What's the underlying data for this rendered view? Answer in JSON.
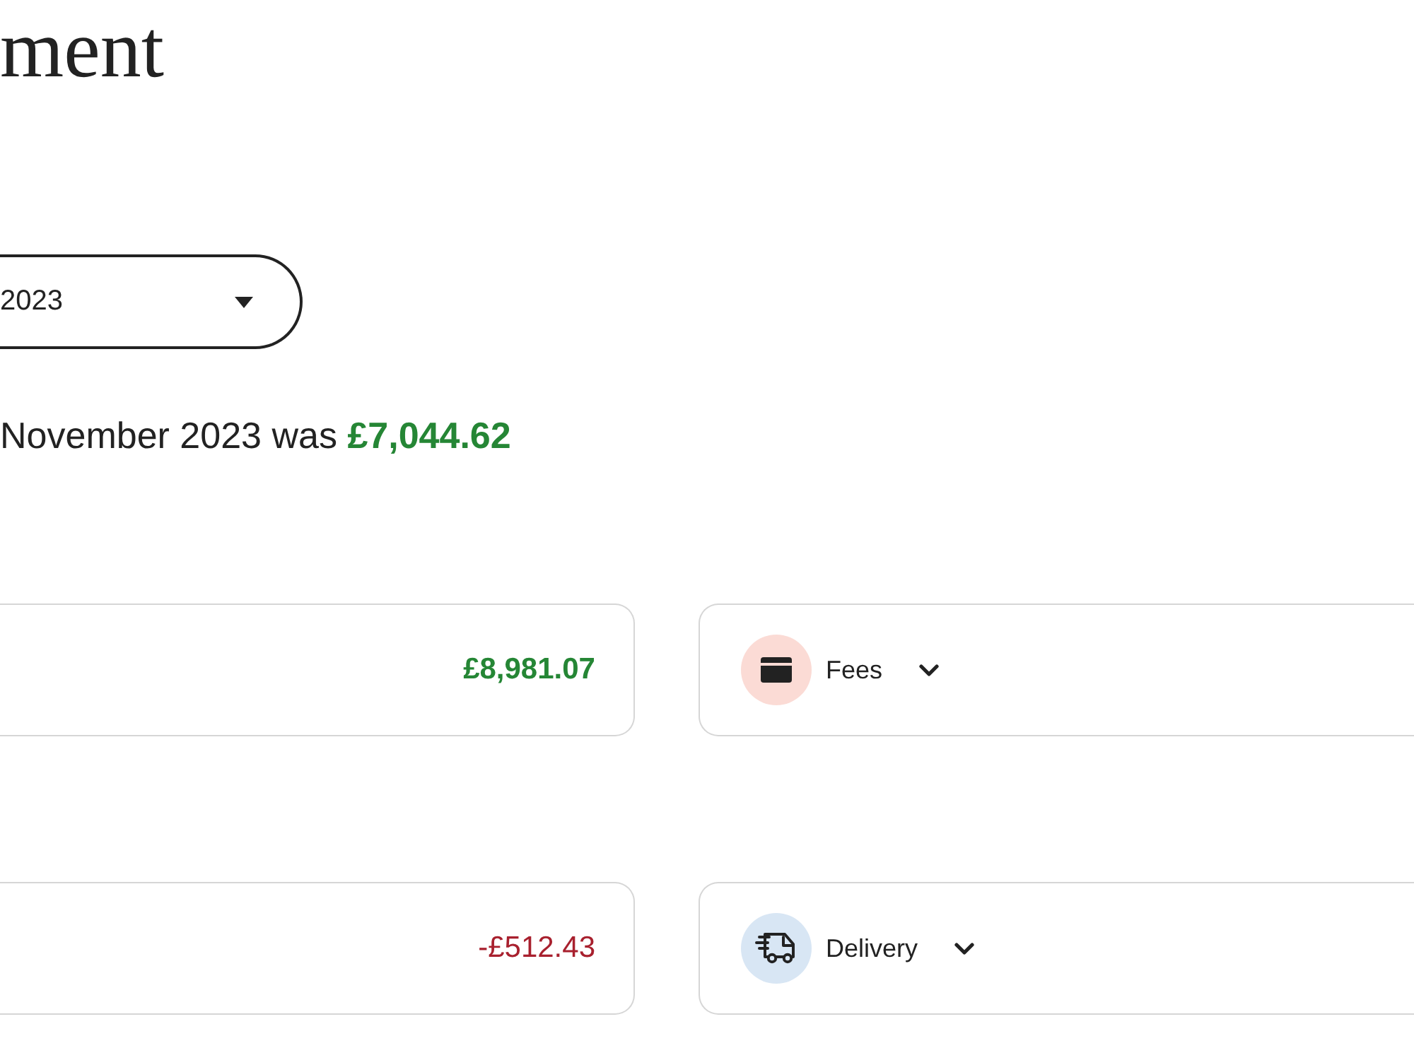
{
  "page_title": "ment",
  "period_select": {
    "value": "2023"
  },
  "summary": {
    "text": "November 2023 was",
    "amount": "£7,044.62"
  },
  "sections": [
    {
      "total": {
        "amount": "£8,981.07",
        "kind": "credit"
      },
      "breakdown": {
        "kind": "fees",
        "label": "Fees",
        "expanded": false
      }
    },
    {
      "total": {
        "amount": "-£512.43",
        "kind": "debit"
      },
      "breakdown": {
        "kind": "delivery",
        "label": "Delivery",
        "expanded": false
      }
    }
  ]
}
